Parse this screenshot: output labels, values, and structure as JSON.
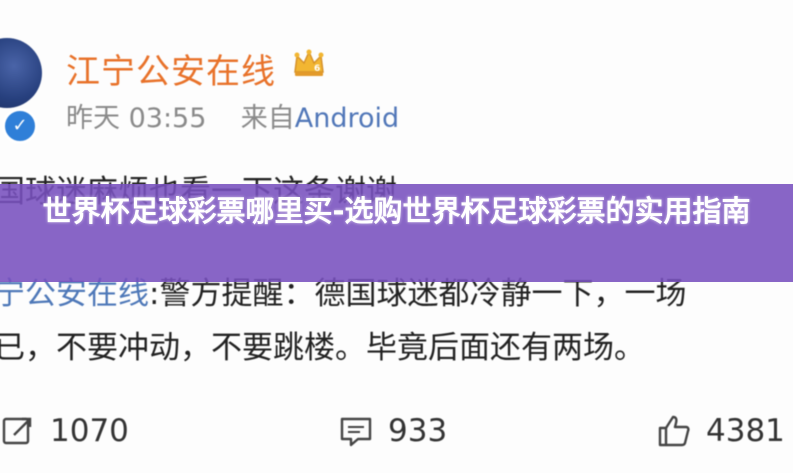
{
  "post": {
    "username": "江宁公安在线",
    "time": "昨天 03:55",
    "source_prefix": "来自",
    "source": "Android",
    "content_line1": "国球迷麻烦也看一下这条谢谢",
    "content_line2_mention": "宁公安在线",
    "content_line2_rest": ":警方提醒：德国球迷都冷静一下，一场",
    "content_line3": "已，不要冲动，不要跳楼。毕竟后面还有两场。"
  },
  "actions": {
    "repost_count": "1070",
    "comment_count": "933",
    "like_count": "4381"
  },
  "banner": {
    "title": "世界杯足球彩票哪里买-选购世界杯足球彩票的实用指南"
  },
  "colors": {
    "username": "#e8722a",
    "mention": "#4e78b8",
    "banner": "#7850be",
    "verified": "#2f7fd8"
  },
  "icons": {
    "repost": "repost-icon",
    "comment": "comment-icon",
    "like": "thumbs-up-icon",
    "crown": "crown-badge-icon",
    "verified": "verified-check-icon"
  }
}
